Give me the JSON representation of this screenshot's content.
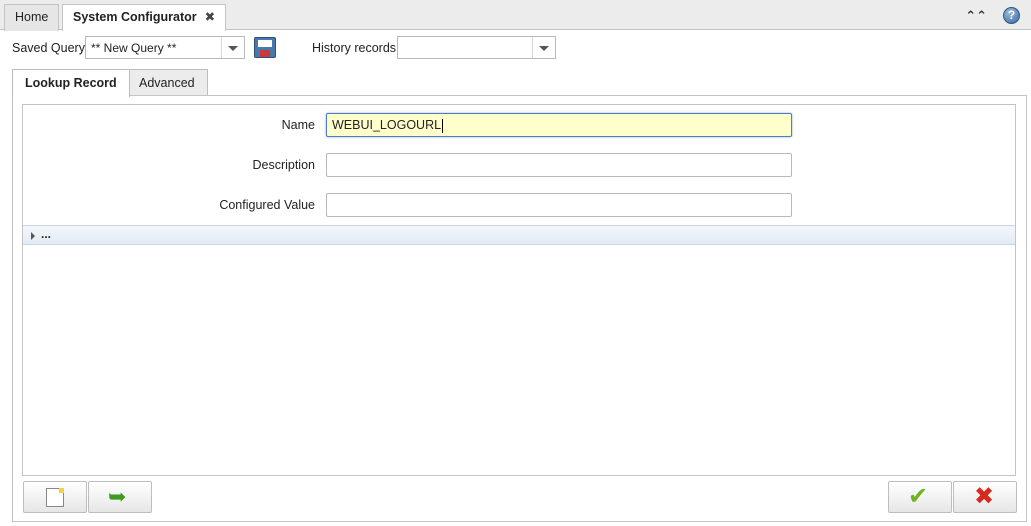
{
  "tabs": [
    {
      "label": "Home"
    },
    {
      "label": "System Configurator",
      "close": "✖"
    }
  ],
  "window_controls": {
    "collapse_glyph": "⌃⌃",
    "help_glyph": "?"
  },
  "toolbar": {
    "saved_query_label": "Saved Query",
    "saved_query_value": "** New Query **",
    "history_label": "History records",
    "history_value": ""
  },
  "subtabs": [
    {
      "label": "Lookup Record",
      "active": true
    },
    {
      "label": "Advanced",
      "active": false
    }
  ],
  "form": {
    "name_label": "Name",
    "name_value": "WEBUI_LOGOURL",
    "description_label": "Description",
    "description_value": "",
    "configured_value_label": "Configured Value",
    "configured_value_value": ""
  },
  "collapsible": {
    "label": "..."
  },
  "buttons": {
    "new_icon": "new-record-icon",
    "refresh_icon": "refresh-icon",
    "refresh_glyph": "➥",
    "ok_icon": "checkmark-icon",
    "ok_glyph": "✔",
    "cancel_icon": "cancel-icon",
    "cancel_glyph": "✖"
  },
  "colors": {
    "focused_field_bg": "#ffffcc",
    "ok_green": "#6fb31d",
    "cancel_red": "#d62a1e"
  }
}
